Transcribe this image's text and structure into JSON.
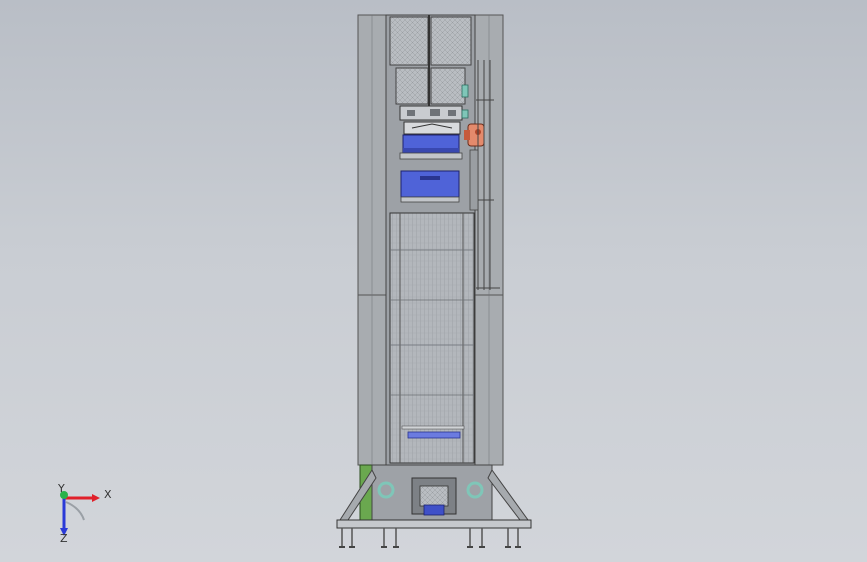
{
  "viewport": {
    "background_top": "#b9bec6",
    "background_bottom": "#d2d5da"
  },
  "triad": {
    "x_label": "X",
    "y_label": "Y",
    "z_label": "Z",
    "x_color": "#e0202a",
    "y_color": "#2ab24a",
    "z_color": "#2a3ad8"
  },
  "model": {
    "frame_color": "#8e9296",
    "panel_color": "#a9adb1",
    "mesh_color": "#b8bcc0",
    "accent_blue": "#4a5fd6",
    "accent_orange": "#e07a5a",
    "accent_green": "#6aa84f",
    "accent_teal": "#7fc6b8"
  }
}
